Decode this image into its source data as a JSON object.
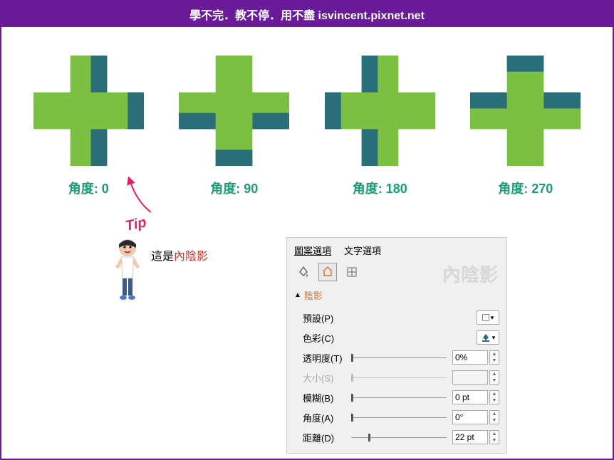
{
  "header": "學不完．教不停．用不盡 isvincent.pixnet.net",
  "crosses": [
    {
      "label": "角度: 0"
    },
    {
      "label": "角度: 90"
    },
    {
      "label": "角度: 180"
    },
    {
      "label": "角度: 270"
    }
  ],
  "tip": {
    "text": "Tip",
    "message_prefix": "這是",
    "message_highlight": "內陰影"
  },
  "panel": {
    "tabs": [
      "圖案選項",
      "文字選項"
    ],
    "watermark": "內陰影",
    "section_title": "陰影",
    "rows": {
      "preset": {
        "label": "預設(P)"
      },
      "color": {
        "label": "色彩(C)"
      },
      "transparency": {
        "label": "透明度(T)",
        "value": "0%"
      },
      "size": {
        "label": "大小(S)"
      },
      "blur": {
        "label": "模糊(B)",
        "value": "0 pt"
      },
      "angle": {
        "label": "角度(A)",
        "value": "0°"
      },
      "distance": {
        "label": "距離(D)",
        "value": "22 pt"
      }
    }
  }
}
